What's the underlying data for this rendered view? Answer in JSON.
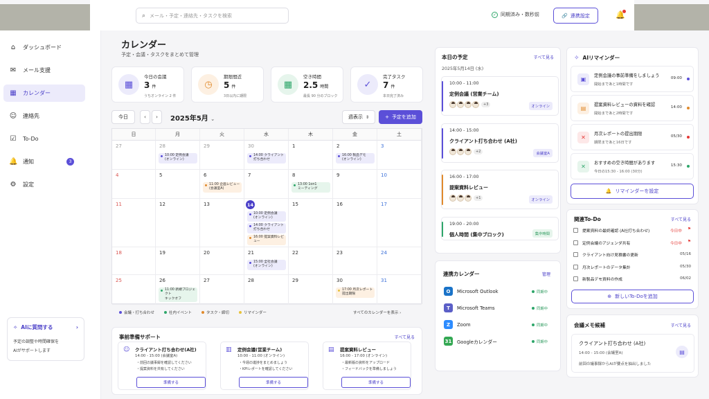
{
  "search": {
    "placeholder": "メール・予定・連絡先・タスクを検索"
  },
  "header": {
    "sync_status": "同期済み・数秒前",
    "link_button": "連携設定"
  },
  "sidebar": {
    "items": [
      {
        "label": "ダッシュボード",
        "icon": "home-icon"
      },
      {
        "label": "メール支援",
        "icon": "mail-icon"
      },
      {
        "label": "カレンダー",
        "icon": "calendar-icon"
      },
      {
        "label": "連絡先",
        "icon": "contacts-icon"
      },
      {
        "label": "To-Do",
        "icon": "checkbox-icon"
      },
      {
        "label": "通知",
        "icon": "bell-icon",
        "badge": "3"
      },
      {
        "label": "設定",
        "icon": "gear-icon"
      }
    ],
    "ai_box": {
      "title": "AIに質問する",
      "desc1": "予定の調整や時間確保を",
      "desc2": "AIがサポートします"
    }
  },
  "page": {
    "title": "カレンダー",
    "subtitle": "予定・会議・タスクをまとめて管理"
  },
  "stats": [
    {
      "label": "今日の会議",
      "value": "3",
      "unit": "件",
      "note": "うちオンライン 2 件",
      "color": "#ecebfb",
      "icon_color": "#5b4fd8"
    },
    {
      "label": "期限間近",
      "value": "5",
      "unit": "件",
      "note": "3日以内に期限",
      "color": "#fdf0e2",
      "icon_color": "#e08a2c"
    },
    {
      "label": "空き時間",
      "value": "2.5",
      "unit": "時間",
      "note": "最長 90 分のブロック",
      "color": "#e6f5ec",
      "icon_color": "#2ea66a"
    },
    {
      "label": "完了タスク",
      "value": "7",
      "unit": "件",
      "note": "本日完了済み",
      "color": "#ecebfb",
      "icon_color": "#5b4fd8"
    }
  ],
  "controls": {
    "today": "今日",
    "month": "2025年5月",
    "view": "週表示",
    "add": "予定を追加"
  },
  "calendar": {
    "weekdays": [
      "日",
      "月",
      "火",
      "水",
      "木",
      "金",
      "土"
    ],
    "weeks": [
      [
        {
          "d": "27",
          "m": true
        },
        {
          "d": "28",
          "m": true
        },
        {
          "d": "29",
          "m": true
        },
        {
          "d": "30",
          "m": true
        },
        {
          "d": "1"
        },
        {
          "d": "2"
        },
        {
          "d": "3"
        }
      ],
      [
        {
          "d": "4"
        },
        {
          "d": "5"
        },
        {
          "d": "6"
        },
        {
          "d": "7"
        },
        {
          "d": "8"
        },
        {
          "d": "9"
        },
        {
          "d": "10"
        }
      ],
      [
        {
          "d": "11"
        },
        {
          "d": "12"
        },
        {
          "d": "13"
        },
        {
          "d": "14",
          "today": true
        },
        {
          "d": "15"
        },
        {
          "d": "16"
        },
        {
          "d": "17"
        }
      ],
      [
        {
          "d": "18"
        },
        {
          "d": "19"
        },
        {
          "d": "20"
        },
        {
          "d": "21"
        },
        {
          "d": "22"
        },
        {
          "d": "23"
        },
        {
          "d": "24"
        }
      ],
      [
        {
          "d": "25"
        },
        {
          "d": "26"
        },
        {
          "d": "27"
        },
        {
          "d": "28"
        },
        {
          "d": "29"
        },
        {
          "d": "30"
        },
        {
          "d": "31"
        }
      ]
    ],
    "events": [
      {
        "w": 0,
        "c": 1,
        "i": 0,
        "text": "10:00 定例会議\n(オンライン)",
        "kind": "meeting"
      },
      {
        "w": 0,
        "c": 3,
        "i": 0,
        "text": "14:00 クライアント\n打ち合わせ",
        "kind": "meeting"
      },
      {
        "w": 0,
        "c": 5,
        "i": 0,
        "text": "16:00 製品デモ\n(オンライン)",
        "kind": "meeting"
      },
      {
        "w": 1,
        "c": 2,
        "i": 0,
        "text": "11:00 企画レビュー\n(会議室A)",
        "kind": "task"
      },
      {
        "w": 1,
        "c": 4,
        "i": 0,
        "text": "13:00 1on1\nミーティング",
        "kind": "event"
      },
      {
        "w": 2,
        "c": 3,
        "i": 0,
        "text": "10:00 定例会議\n(オンライン)",
        "kind": "meeting"
      },
      {
        "w": 2,
        "c": 3,
        "i": 1,
        "text": "14:00 クライアント\n打ち合わせ",
        "kind": "meeting"
      },
      {
        "w": 2,
        "c": 3,
        "i": 2,
        "text": "16:00 提案資料レビュー",
        "kind": "task"
      },
      {
        "w": 3,
        "c": 3,
        "i": 0,
        "text": "15:00 全社会議\n(オンライン)",
        "kind": "meeting"
      },
      {
        "w": 4,
        "c": 1,
        "i": 0,
        "text": "11:00 新規プロジェクト\nキックオフ",
        "kind": "event"
      },
      {
        "w": 4,
        "c": 5,
        "i": 0,
        "text": "17:00 月次レポート\n提出期限",
        "kind": "reminder"
      }
    ]
  },
  "legend": [
    {
      "label": "会議・打ち合わせ",
      "color": "#5b4fd8"
    },
    {
      "label": "社内イベント",
      "color": "#2ea66a"
    },
    {
      "label": "タスク・締切",
      "color": "#e08a2c"
    },
    {
      "label": "リマインダー",
      "color": "#e8c23a"
    }
  ],
  "all_calendars": "すべてのカレンダーを表示",
  "prep": {
    "title": "事前準備サポート",
    "link": "すべて見る",
    "cards": [
      {
        "title": "クライアント打ち合わせ(A社)",
        "time": "14:00 - 15:00 (会議室A)",
        "b1": "・前回の議事録を確認してください",
        "b2": "・提案資料を共有してください",
        "btn": "準備する",
        "icon": "people-icon"
      },
      {
        "title": "定例会議(営業チーム)",
        "time": "10:00 - 11:00 (オンライン)",
        "b1": "・今週の進捗をまとめましょう",
        "b2": "・KPIレポートを確認してください",
        "btn": "準備する",
        "icon": "chart-icon"
      },
      {
        "title": "提案資料レビュー",
        "time": "16:00 - 17:00 (オンライン)",
        "b1": "・最新版の資料をアップロード",
        "b2": "・フィードバックを準備しましょう",
        "btn": "準備する",
        "icon": "document-icon"
      }
    ]
  },
  "today": {
    "title": "本日の予定",
    "link": "すべて見る",
    "date": "2025年5月14日 (水)",
    "items": [
      {
        "time": "10:00 - 11:00",
        "name": "定例会議 (営業チーム)",
        "more": "+3",
        "tag": "オンライン",
        "accent": "#5b4fd8",
        "tag_bg": "#ecebfb",
        "tag_fg": "#4a3fc8"
      },
      {
        "time": "14:00 - 15:00",
        "name": "クライアント打ち合わせ (A社)",
        "more": "+2",
        "tag": "会議室A",
        "accent": "#5b4fd8",
        "tag_bg": "#ecebfb",
        "tag_fg": "#4a3fc8"
      },
      {
        "time": "16:00 - 17:00",
        "name": "提案資料レビュー",
        "more": "+1",
        "tag": "オンライン",
        "accent": "#e08a2c",
        "tag_bg": "#ecebfb",
        "tag_fg": "#4a3fc8"
      },
      {
        "time": "19:00 - 20:00",
        "name": "個人時間 (集中ブロック)",
        "more": "",
        "tag": "集中時間",
        "accent": "#2ea66a",
        "tag_bg": "#e6f5ec",
        "tag_fg": "#2e9a5e"
      }
    ]
  },
  "connected": {
    "title": "連携カレンダー",
    "link": "管理",
    "items": [
      {
        "name": "Microsoft Outlook",
        "status": "同期中",
        "color": "#1a73c8",
        "glyph": "O"
      },
      {
        "name": "Microsoft Teams",
        "status": "同期中",
        "color": "#5b5fc7",
        "glyph": "T"
      },
      {
        "name": "Zoom",
        "status": "同期中",
        "color": "#2d8cff",
        "glyph": "Z"
      },
      {
        "name": "Googleカレンダー",
        "status": "同期中",
        "color": "#34a853",
        "glyph": "31"
      }
    ]
  },
  "reminders": {
    "title": "AIリマインダー",
    "items": [
      {
        "l1": "定例会議の事前準備をしましょう",
        "l2": "開始まであと1時間です",
        "time": "09:00",
        "color": "#5b4fd8",
        "bg": "#ecebfb"
      },
      {
        "l1": "提案資料レビューの資料を確認",
        "l2": "開始まであと2時間です",
        "time": "14:00",
        "color": "#e08a2c",
        "bg": "#fdf0e2"
      },
      {
        "l1": "月次レポートの提出期限",
        "l2": "期限まであと16日です",
        "time": "05/30",
        "color": "#e53935",
        "bg": "#fde8e8"
      },
      {
        "l1": "おすすめの空き時間があります",
        "l2": "今日の15:30 - 16:00 (30分)",
        "time": "15:30",
        "color": "#2ea66a",
        "bg": "#e6f5ec"
      }
    ],
    "button": "リマインダーを設定"
  },
  "todo": {
    "title": "関連To-Do",
    "link": "すべて見る",
    "items": [
      {
        "text": "提案資料の最終確認 (A社打ち合わせ)",
        "due": "今日中",
        "flag": "#e53935",
        "hot": true
      },
      {
        "text": "定例会議のアジェンダ共有",
        "due": "今日中",
        "flag": "#e53935",
        "hot": true
      },
      {
        "text": "クライアント向け見積書の更新",
        "due": "05/16",
        "flag": "",
        "hot": false
      },
      {
        "text": "月次レポートのデータ集計",
        "due": "05/30",
        "flag": "",
        "hot": false
      },
      {
        "text": "新製品デモ資料の作成",
        "due": "06/02",
        "flag": "",
        "hot": false
      }
    ],
    "button": "新しいTo-Doを追加"
  },
  "memo": {
    "title": "会議メモ候補",
    "link": "すべて見る",
    "name": "クライアント打ち合わせ (A社)",
    "time": "14:00 - 15:00 (会議室A)",
    "desc": "前回の議事録からAIが要点を抽出しました"
  }
}
